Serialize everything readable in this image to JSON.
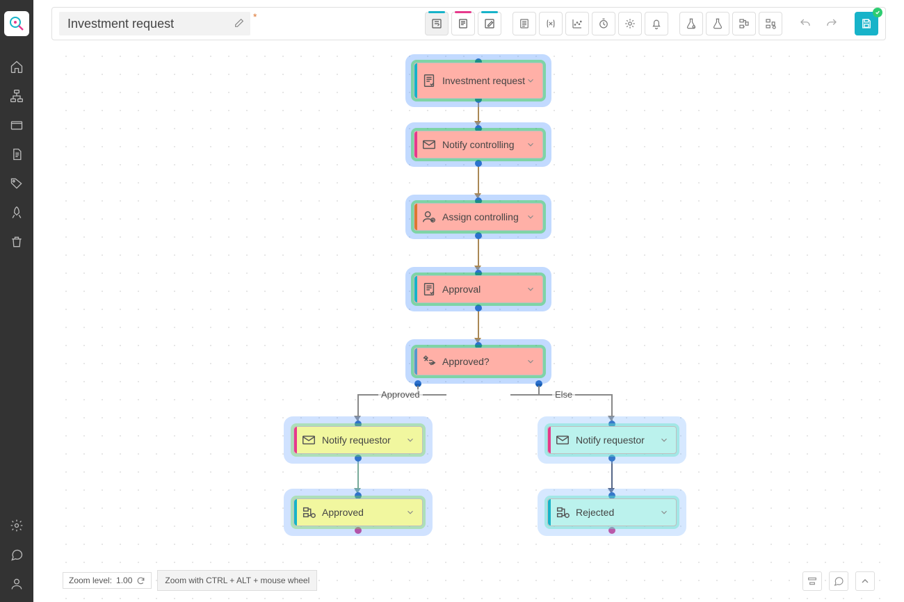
{
  "title": "Investment request",
  "footer": {
    "zoom_label": "Zoom level:",
    "zoom_value": "1.00",
    "hint": "Zoom with CTRL + ALT + mouse wheel"
  },
  "branches": {
    "left": "Approved",
    "right": "Else"
  },
  "nodes": {
    "n1": "Investment request",
    "n2": "Notify controlling",
    "n3": "Assign controlling",
    "n4": "Approval",
    "n5": "Approved?",
    "n6": "Notify requestor",
    "n7": "Approved",
    "n8": "Notify requestor",
    "n9": "Rejected"
  }
}
